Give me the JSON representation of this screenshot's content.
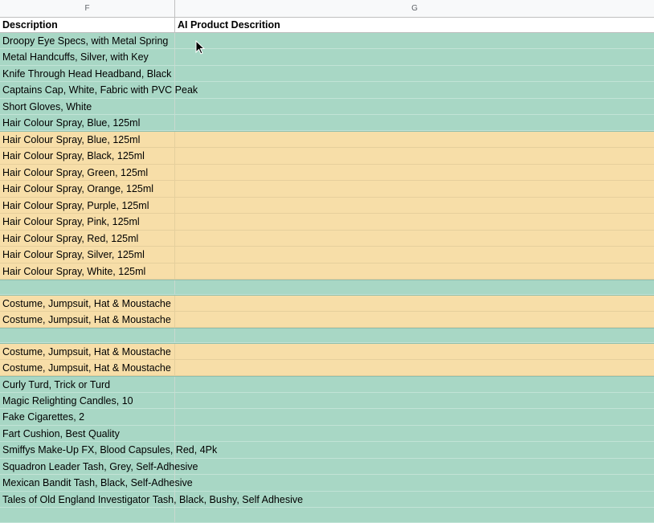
{
  "columns": [
    {
      "letter": "F"
    },
    {
      "letter": "G"
    }
  ],
  "header_row": {
    "f": "Description",
    "g": "AI Product Descrition"
  },
  "colors": {
    "teal": "#a8d7c5",
    "orange": "#f7dea8",
    "header_bg": "#f8f9fa"
  },
  "rows": [
    {
      "f": "Droopy Eye Specs, with Metal Spring",
      "g": "",
      "fill": "teal"
    },
    {
      "f": "Metal Handcuffs, Silver, with Key",
      "g": "",
      "fill": "teal"
    },
    {
      "f": "Knife Through Head Headband, Black",
      "g": "",
      "fill": "teal"
    },
    {
      "f": "Captains Cap, White, Fabric with PVC Peak",
      "g": "",
      "fill": "teal"
    },
    {
      "f": "Short Gloves, White",
      "g": "",
      "fill": "teal"
    },
    {
      "f": "Hair Colour Spray, Blue, 125ml",
      "g": "",
      "fill": "teal"
    },
    {
      "f": "Hair Colour Spray, Blue, 125ml",
      "g": "",
      "fill": "orange"
    },
    {
      "f": "Hair Colour Spray, Black, 125ml",
      "g": "",
      "fill": "orange"
    },
    {
      "f": "Hair Colour Spray, Green, 125ml",
      "g": "",
      "fill": "orange"
    },
    {
      "f": "Hair Colour Spray, Orange, 125ml",
      "g": "",
      "fill": "orange"
    },
    {
      "f": "Hair Colour Spray, Purple, 125ml",
      "g": "",
      "fill": "orange"
    },
    {
      "f": "Hair Colour Spray, Pink, 125ml",
      "g": "",
      "fill": "orange"
    },
    {
      "f": "Hair Colour Spray, Red, 125ml",
      "g": "",
      "fill": "orange"
    },
    {
      "f": "Hair Colour Spray, Silver, 125ml",
      "g": "",
      "fill": "orange"
    },
    {
      "f": "Hair Colour Spray, White, 125ml",
      "g": "",
      "fill": "orange"
    },
    {
      "f": "",
      "g": "",
      "fill": "teal"
    },
    {
      "f": "Costume, Jumpsuit, Hat & Moustache",
      "g": "",
      "fill": "orange"
    },
    {
      "f": "Costume, Jumpsuit, Hat & Moustache",
      "g": "",
      "fill": "orange"
    },
    {
      "f": "",
      "g": "",
      "fill": "teal"
    },
    {
      "f": "Costume, Jumpsuit, Hat & Moustache",
      "g": "",
      "fill": "orange"
    },
    {
      "f": "Costume, Jumpsuit, Hat & Moustache",
      "g": "",
      "fill": "orange"
    },
    {
      "f": "Curly Turd, Trick or Turd",
      "g": "",
      "fill": "teal"
    },
    {
      "f": "Magic Relighting Candles, 10",
      "g": "",
      "fill": "teal"
    },
    {
      "f": "Fake Cigarettes, 2",
      "g": "",
      "fill": "teal"
    },
    {
      "f": "Fart Cushion, Best Quality",
      "g": "",
      "fill": "teal"
    },
    {
      "f": "Smiffys Make-Up FX, Blood Capsules, Red, 4Pk",
      "g": "",
      "fill": "teal"
    },
    {
      "f": "Squadron Leader Tash, Grey, Self-Adhesive",
      "g": "",
      "fill": "teal"
    },
    {
      "f": "Mexican Bandit Tash, Black, Self-Adhesive",
      "g": "",
      "fill": "teal"
    },
    {
      "f": "Tales of Old England Investigator Tash, Black, Bushy, Self Adhesive",
      "g": "",
      "fill": "teal"
    },
    {
      "f": "",
      "g": "",
      "fill": "teal"
    }
  ]
}
